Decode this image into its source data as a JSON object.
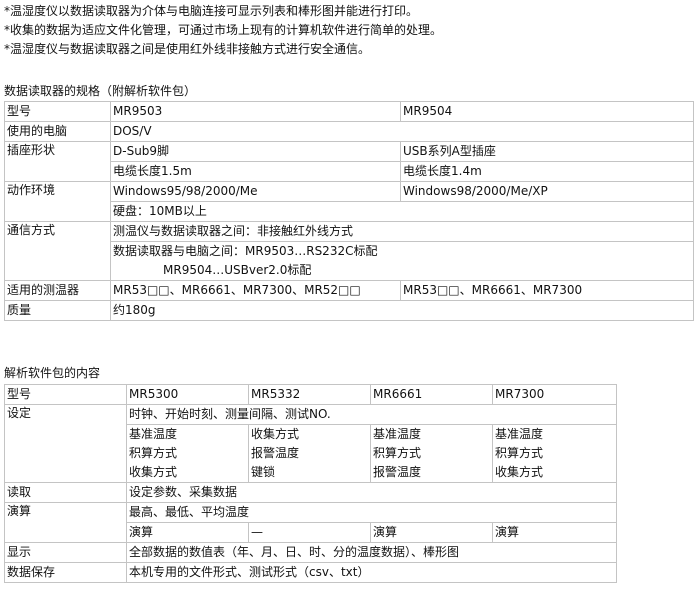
{
  "intro": [
    "*温湿度仪以数据读取器为介体与电脑连接可显示列表和棒形图并能进行打印。",
    "*收集的数据为适应文件化管理，可通过市场上现有的计算机软件进行简单的处理。",
    "*温湿度仪与数据读取器之间是使用红外线非接触方式进行安全通信。"
  ],
  "spec": {
    "heading": "数据读取器的规格（附解析软件包）",
    "model_label": "型号",
    "model_a": "MR9503",
    "model_b": "MR9504",
    "pc_label": "使用的电脑",
    "pc_value": "DOS/V",
    "socket_label": "插座形状",
    "socket_a": "D-Sub9脚",
    "socket_b": "USB系列A型插座",
    "cable_a": "电缆长度1.5m",
    "cable_b": "电缆长度1.4m",
    "env_label": "动作环境",
    "env_a": "Windows95/98/2000/Me",
    "env_b": "Windows98/2000/Me/XP",
    "disk": "硬盘：10MB以上",
    "comm_label": "通信方式",
    "comm_1": "测温仪与数据读取器之间：非接触红外线方式",
    "comm_2": "数据读取器与电脑之间：MR9503…RS232C标配",
    "comm_3": "MR9504…USBver2.0标配",
    "meters_label": "适用的测温器",
    "meters_a": "MR53□□、MR6661、MR7300、MR52□□",
    "meters_b": "MR53□□、MR6661、MR7300",
    "mass_label": "质量",
    "mass_value": "约180g"
  },
  "soft": {
    "heading": "解析软件包的内容",
    "model_label": "型号",
    "models": [
      "MR5300",
      "MR5332",
      "MR6661",
      "MR7300"
    ],
    "settings_label": "设定",
    "settings_common": "时钟、开始时刻、测量间隔、测试NO.",
    "settings_r1": [
      "基准温度",
      "收集方式",
      "基准温度",
      "基准温度"
    ],
    "settings_r2": [
      "积算方式",
      "报警温度",
      "积算方式",
      "积算方式"
    ],
    "settings_r3": [
      "收集方式",
      "键锁",
      "报警温度",
      "收集方式"
    ],
    "read_label": "读取",
    "read_value": "设定参数、采集数据",
    "calc_label": "演算",
    "calc_common": "最高、最低、平均温度",
    "calc_r": [
      "演算",
      "—",
      "演算",
      "演算"
    ],
    "display_label": "显示",
    "display_value": "全部数据的数值表（年、月、日、时、分的温度数据）、棒形图",
    "save_label": "数据保存",
    "save_value": "本机专用的文件形式、测试形式（csv、txt）"
  }
}
